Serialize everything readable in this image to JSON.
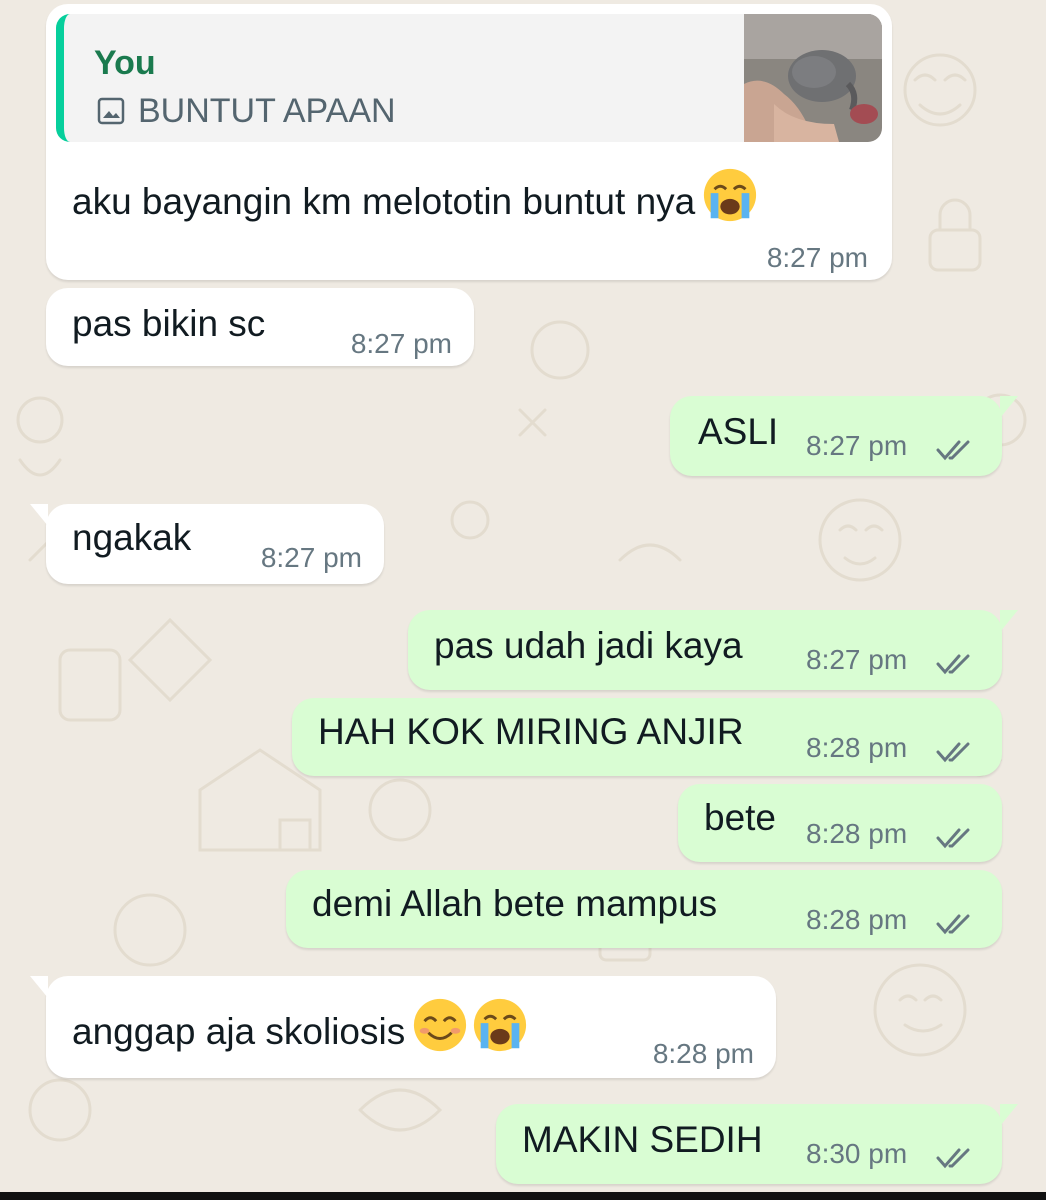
{
  "chat": {
    "quoted_message": {
      "author": "You",
      "caption": "BUNTUT APAAN",
      "photo_icon": "photo-icon"
    },
    "messages": [
      {
        "id": "m1",
        "direction": "incoming",
        "text": "aku bayangin km melototin buntut nya",
        "emojis": [
          "loudly-crying-face"
        ],
        "time": "8:27 pm"
      },
      {
        "id": "m2",
        "direction": "incoming",
        "text": "pas bikin sc",
        "time": "8:27 pm"
      },
      {
        "id": "m3",
        "direction": "outgoing",
        "text": "ASLI",
        "time": "8:27 pm",
        "status": "read-double-check"
      },
      {
        "id": "m4",
        "direction": "incoming",
        "text": "ngakak",
        "time": "8:27 pm"
      },
      {
        "id": "m5",
        "direction": "outgoing",
        "text": "pas udah jadi kaya",
        "time": "8:27 pm",
        "status": "read-double-check"
      },
      {
        "id": "m6",
        "direction": "outgoing",
        "text": "HAH KOK MIRING ANJIR",
        "time": "8:28 pm",
        "status": "read-double-check"
      },
      {
        "id": "m7",
        "direction": "outgoing",
        "text": "bete",
        "time": "8:28 pm",
        "status": "read-double-check"
      },
      {
        "id": "m8",
        "direction": "outgoing",
        "text": "demi Allah bete mampus",
        "time": "8:28 pm",
        "status": "read-double-check"
      },
      {
        "id": "m9",
        "direction": "incoming",
        "text": "anggap aja skoliosis",
        "emojis": [
          "smiling-face-with-smiling-eyes",
          "loudly-crying-face"
        ],
        "time": "8:28 pm"
      },
      {
        "id": "m10",
        "direction": "outgoing",
        "text": "MAKIN SEDIH",
        "time": "8:30 pm",
        "status": "read-double-check"
      }
    ]
  },
  "colors": {
    "background": "#efeae2",
    "incoming_bubble": "#ffffff",
    "outgoing_bubble": "#d9fdd3",
    "quote_bar": "#06cf9c",
    "quote_author": "#1a7a4e",
    "timestamp": "#667781",
    "read_ticks": "#667781"
  }
}
